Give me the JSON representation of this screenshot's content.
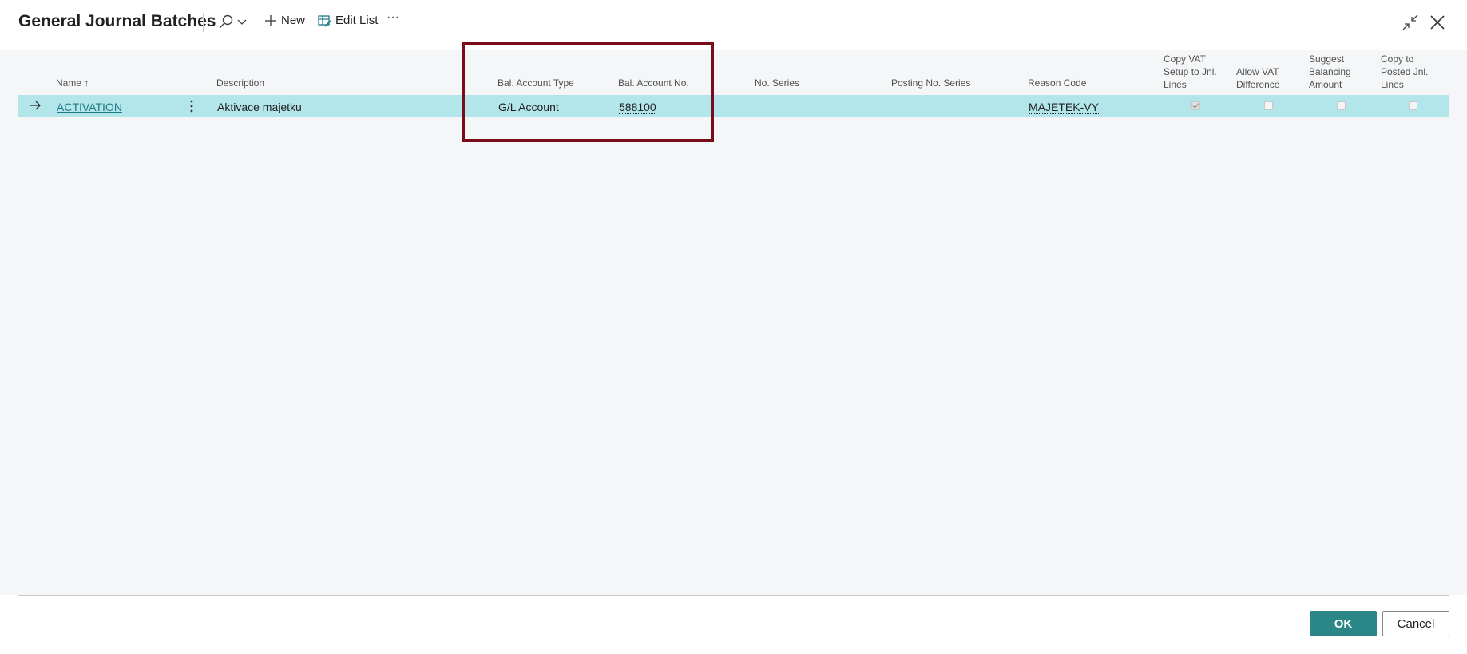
{
  "header": {
    "title": "General Journal Batches",
    "new_label": "New",
    "edit_list_label": "Edit List",
    "more_label": "···"
  },
  "columns": {
    "name": "Name",
    "sort_indicator": "↑",
    "description": "Description",
    "bal_account_type": "Bal. Account Type",
    "bal_account_no": "Bal. Account No.",
    "no_series": "No. Series",
    "posting_no_series": "Posting No. Series",
    "reason_code": "Reason Code",
    "copy_vat": [
      "Copy VAT",
      "Setup to Jnl.",
      "Lines"
    ],
    "allow_vat": [
      "Allow VAT",
      "Difference"
    ],
    "suggest_balancing": [
      "Suggest",
      "Balancing",
      "Amount"
    ],
    "copy_to_posted": [
      "Copy to",
      "Posted Jnl.",
      "Lines"
    ]
  },
  "rows": [
    {
      "name": "ACTIVATION",
      "description": "Aktivace majetku",
      "bal_account_type": "G/L Account",
      "bal_account_no": "588100",
      "no_series": "",
      "posting_no_series": "",
      "reason_code": "MAJETEK-VY",
      "copy_vat_setup": true,
      "allow_vat_difference": false,
      "suggest_balancing_amount": false,
      "copy_to_posted_jnl_lines": false
    }
  ],
  "footer": {
    "ok_label": "OK",
    "cancel_label": "Cancel"
  },
  "colors": {
    "accent": "#2a8687",
    "selected_row": "#b3e6ea",
    "highlight_box": "#7b0c1a",
    "link": "#1f7a84"
  },
  "icons": {
    "search": "search-icon",
    "chevron": "chevron-down-icon",
    "new": "plus-icon",
    "edit_list": "edit-list-icon",
    "collapse": "collapse-icon",
    "close": "close-icon",
    "row_arrow": "arrow-right-icon",
    "row_menu": "more-vertical-icon"
  }
}
